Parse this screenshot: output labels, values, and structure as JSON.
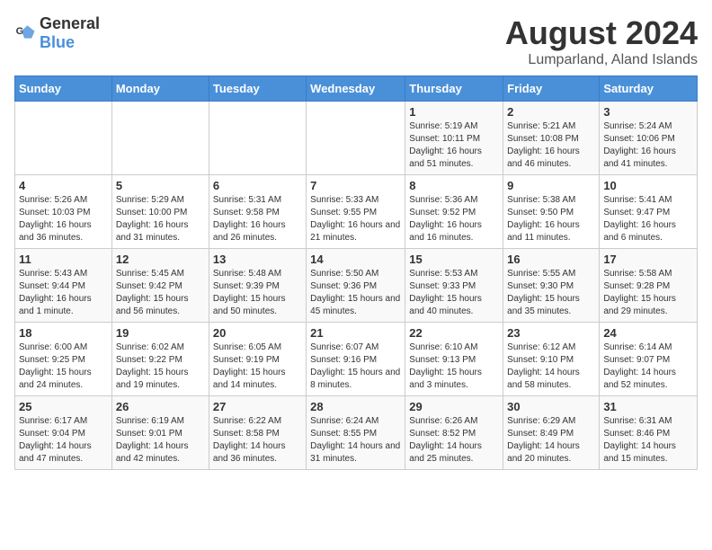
{
  "logo": {
    "general": "General",
    "blue": "Blue"
  },
  "title": "August 2024",
  "subtitle": "Lumparland, Aland Islands",
  "days_of_week": [
    "Sunday",
    "Monday",
    "Tuesday",
    "Wednesday",
    "Thursday",
    "Friday",
    "Saturday"
  ],
  "weeks": [
    [
      {
        "day": "",
        "sunrise": "",
        "sunset": "",
        "daylight": ""
      },
      {
        "day": "",
        "sunrise": "",
        "sunset": "",
        "daylight": ""
      },
      {
        "day": "",
        "sunrise": "",
        "sunset": "",
        "daylight": ""
      },
      {
        "day": "",
        "sunrise": "",
        "sunset": "",
        "daylight": ""
      },
      {
        "day": "1",
        "sunrise": "Sunrise: 5:19 AM",
        "sunset": "Sunset: 10:11 PM",
        "daylight": "Daylight: 16 hours and 51 minutes."
      },
      {
        "day": "2",
        "sunrise": "Sunrise: 5:21 AM",
        "sunset": "Sunset: 10:08 PM",
        "daylight": "Daylight: 16 hours and 46 minutes."
      },
      {
        "day": "3",
        "sunrise": "Sunrise: 5:24 AM",
        "sunset": "Sunset: 10:06 PM",
        "daylight": "Daylight: 16 hours and 41 minutes."
      }
    ],
    [
      {
        "day": "4",
        "sunrise": "Sunrise: 5:26 AM",
        "sunset": "Sunset: 10:03 PM",
        "daylight": "Daylight: 16 hours and 36 minutes."
      },
      {
        "day": "5",
        "sunrise": "Sunrise: 5:29 AM",
        "sunset": "Sunset: 10:00 PM",
        "daylight": "Daylight: 16 hours and 31 minutes."
      },
      {
        "day": "6",
        "sunrise": "Sunrise: 5:31 AM",
        "sunset": "Sunset: 9:58 PM",
        "daylight": "Daylight: 16 hours and 26 minutes."
      },
      {
        "day": "7",
        "sunrise": "Sunrise: 5:33 AM",
        "sunset": "Sunset: 9:55 PM",
        "daylight": "Daylight: 16 hours and 21 minutes."
      },
      {
        "day": "8",
        "sunrise": "Sunrise: 5:36 AM",
        "sunset": "Sunset: 9:52 PM",
        "daylight": "Daylight: 16 hours and 16 minutes."
      },
      {
        "day": "9",
        "sunrise": "Sunrise: 5:38 AM",
        "sunset": "Sunset: 9:50 PM",
        "daylight": "Daylight: 16 hours and 11 minutes."
      },
      {
        "day": "10",
        "sunrise": "Sunrise: 5:41 AM",
        "sunset": "Sunset: 9:47 PM",
        "daylight": "Daylight: 16 hours and 6 minutes."
      }
    ],
    [
      {
        "day": "11",
        "sunrise": "Sunrise: 5:43 AM",
        "sunset": "Sunset: 9:44 PM",
        "daylight": "Daylight: 16 hours and 1 minute."
      },
      {
        "day": "12",
        "sunrise": "Sunrise: 5:45 AM",
        "sunset": "Sunset: 9:42 PM",
        "daylight": "Daylight: 15 hours and 56 minutes."
      },
      {
        "day": "13",
        "sunrise": "Sunrise: 5:48 AM",
        "sunset": "Sunset: 9:39 PM",
        "daylight": "Daylight: 15 hours and 50 minutes."
      },
      {
        "day": "14",
        "sunrise": "Sunrise: 5:50 AM",
        "sunset": "Sunset: 9:36 PM",
        "daylight": "Daylight: 15 hours and 45 minutes."
      },
      {
        "day": "15",
        "sunrise": "Sunrise: 5:53 AM",
        "sunset": "Sunset: 9:33 PM",
        "daylight": "Daylight: 15 hours and 40 minutes."
      },
      {
        "day": "16",
        "sunrise": "Sunrise: 5:55 AM",
        "sunset": "Sunset: 9:30 PM",
        "daylight": "Daylight: 15 hours and 35 minutes."
      },
      {
        "day": "17",
        "sunrise": "Sunrise: 5:58 AM",
        "sunset": "Sunset: 9:28 PM",
        "daylight": "Daylight: 15 hours and 29 minutes."
      }
    ],
    [
      {
        "day": "18",
        "sunrise": "Sunrise: 6:00 AM",
        "sunset": "Sunset: 9:25 PM",
        "daylight": "Daylight: 15 hours and 24 minutes."
      },
      {
        "day": "19",
        "sunrise": "Sunrise: 6:02 AM",
        "sunset": "Sunset: 9:22 PM",
        "daylight": "Daylight: 15 hours and 19 minutes."
      },
      {
        "day": "20",
        "sunrise": "Sunrise: 6:05 AM",
        "sunset": "Sunset: 9:19 PM",
        "daylight": "Daylight: 15 hours and 14 minutes."
      },
      {
        "day": "21",
        "sunrise": "Sunrise: 6:07 AM",
        "sunset": "Sunset: 9:16 PM",
        "daylight": "Daylight: 15 hours and 8 minutes."
      },
      {
        "day": "22",
        "sunrise": "Sunrise: 6:10 AM",
        "sunset": "Sunset: 9:13 PM",
        "daylight": "Daylight: 15 hours and 3 minutes."
      },
      {
        "day": "23",
        "sunrise": "Sunrise: 6:12 AM",
        "sunset": "Sunset: 9:10 PM",
        "daylight": "Daylight: 14 hours and 58 minutes."
      },
      {
        "day": "24",
        "sunrise": "Sunrise: 6:14 AM",
        "sunset": "Sunset: 9:07 PM",
        "daylight": "Daylight: 14 hours and 52 minutes."
      }
    ],
    [
      {
        "day": "25",
        "sunrise": "Sunrise: 6:17 AM",
        "sunset": "Sunset: 9:04 PM",
        "daylight": "Daylight: 14 hours and 47 minutes."
      },
      {
        "day": "26",
        "sunrise": "Sunrise: 6:19 AM",
        "sunset": "Sunset: 9:01 PM",
        "daylight": "Daylight: 14 hours and 42 minutes."
      },
      {
        "day": "27",
        "sunrise": "Sunrise: 6:22 AM",
        "sunset": "Sunset: 8:58 PM",
        "daylight": "Daylight: 14 hours and 36 minutes."
      },
      {
        "day": "28",
        "sunrise": "Sunrise: 6:24 AM",
        "sunset": "Sunset: 8:55 PM",
        "daylight": "Daylight: 14 hours and 31 minutes."
      },
      {
        "day": "29",
        "sunrise": "Sunrise: 6:26 AM",
        "sunset": "Sunset: 8:52 PM",
        "daylight": "Daylight: 14 hours and 25 minutes."
      },
      {
        "day": "30",
        "sunrise": "Sunrise: 6:29 AM",
        "sunset": "Sunset: 8:49 PM",
        "daylight": "Daylight: 14 hours and 20 minutes."
      },
      {
        "day": "31",
        "sunrise": "Sunrise: 6:31 AM",
        "sunset": "Sunset: 8:46 PM",
        "daylight": "Daylight: 14 hours and 15 minutes."
      }
    ]
  ]
}
